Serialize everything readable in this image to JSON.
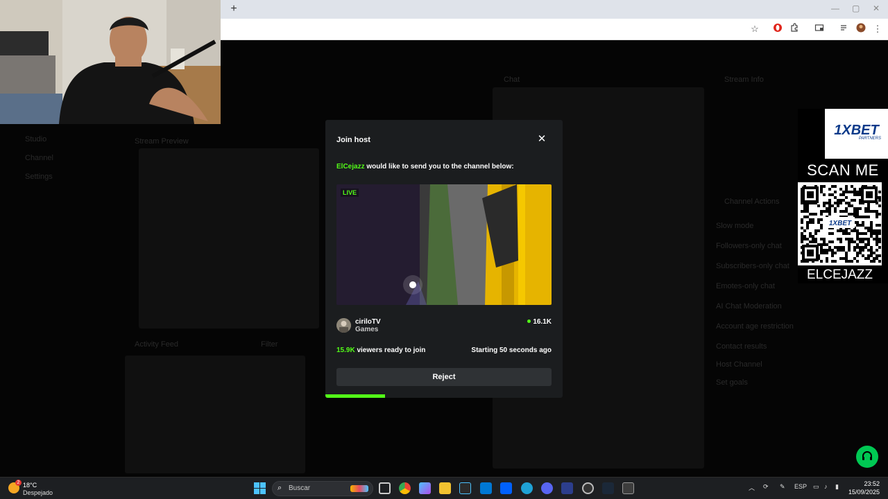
{
  "browser": {
    "new_tab_label": "+",
    "window_controls": [
      "—",
      "▢",
      "✕"
    ]
  },
  "sponsor": {
    "logo": "1XBET",
    "logo_sub": "PARTNERS",
    "scan_label": "SCAN ME",
    "qr_inner_label": "1XBET",
    "name": "ELCEJAZZ"
  },
  "modal": {
    "title": "Join host",
    "close_icon": "close-icon",
    "host_name": "ElCejazz",
    "message": "would like to send you to the channel below:",
    "live_badge": "LIVE",
    "channel_name": "ciriloTV",
    "category": "Games",
    "viewer_count": "16.1K",
    "ready_count": "15.9K",
    "ready_suffix": "viewers ready to join",
    "starting_text": "Starting 50 seconds ago",
    "reject_label": "Reject",
    "progress": 0.25,
    "accent_color": "#53fc18"
  },
  "dashboard_dimmed": {
    "sidebar": [
      "Studio",
      "Channel",
      "Settings"
    ],
    "stream_preview_label": "Stream Preview",
    "activity_feed_label": "Activity Feed",
    "filter_label": "Filter",
    "chat_label": "Chat",
    "stream_info_label": "Stream Info",
    "channel_actions_label": "Channel Actions",
    "actions": [
      "Slow mode",
      "Followers-only chat",
      "Subscribers-only chat",
      "Emotes-only chat",
      "AI Chat Moderation",
      "Account age restriction",
      "Contact results",
      "Host Channel",
      "Set goals"
    ]
  },
  "taskbar": {
    "weather_temp": "18°C",
    "weather_desc": "Despejado",
    "weather_badge": "2",
    "search_placeholder": "Buscar",
    "language": "ESP",
    "time": "23:52",
    "date": "15/09/2025"
  }
}
